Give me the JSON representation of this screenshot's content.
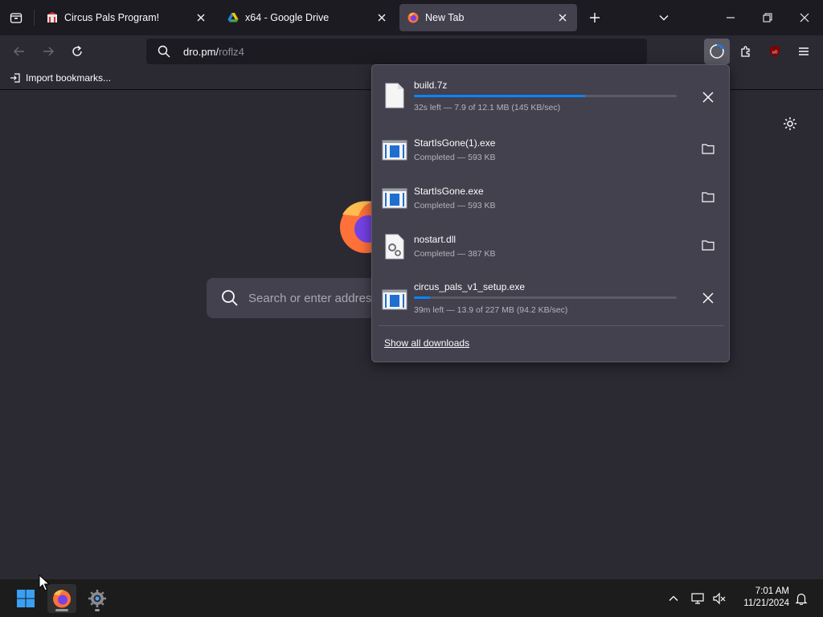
{
  "tabs": [
    {
      "title": "Circus Pals Program!",
      "favicon": "circus-icon"
    },
    {
      "title": "x64 - Google Drive",
      "favicon": "google-drive-icon"
    },
    {
      "title": "New Tab",
      "favicon": "firefox-icon",
      "active": true
    }
  ],
  "urlbar": {
    "domain": "dro.pm/",
    "path": "roflz4"
  },
  "bookmarks": {
    "import_label": "Import bookmarks..."
  },
  "newtab": {
    "search_placeholder": "Search or enter address"
  },
  "downloads": {
    "items": [
      {
        "name": "build.7z",
        "status": "32s left — 7.9 of 12.1 MB (145 KB/sec)",
        "progress": 0.65,
        "icon": "generic-file-icon",
        "action": "cancel"
      },
      {
        "name": "StartIsGone(1).exe",
        "status": "Completed — 593 KB",
        "icon": "exe-file-icon",
        "action": "open-folder"
      },
      {
        "name": "StartIsGone.exe",
        "status": "Completed — 593 KB",
        "icon": "exe-file-icon",
        "action": "open-folder"
      },
      {
        "name": "nostart.dll",
        "status": "Completed — 387 KB",
        "icon": "dll-file-icon",
        "action": "open-folder"
      },
      {
        "name": "circus_pals_v1_setup.exe",
        "status": "39m left — 13.9 of 227 MB (94.2 KB/sec)",
        "progress": 0.06,
        "icon": "exe-file-icon",
        "action": "cancel"
      }
    ],
    "show_all_label": "Show all downloads"
  },
  "taskbar": {
    "time": "7:01 AM",
    "date": "11/21/2024"
  },
  "colors": {
    "accent": "#0a84ff",
    "bg": "#2b2a33",
    "panel": "#42414d",
    "tabstrip": "#1c1b22"
  }
}
